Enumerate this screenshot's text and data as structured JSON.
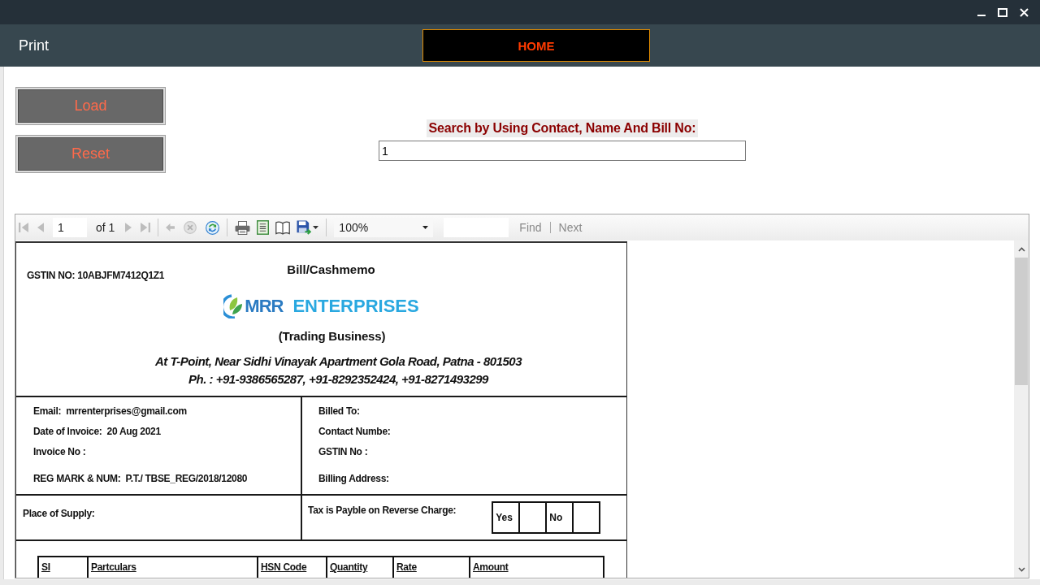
{
  "window": {
    "title": "Print",
    "home_button": "HOME"
  },
  "actions": {
    "buttons": [
      "Load",
      "Reset"
    ]
  },
  "search": {
    "label": "Search by Using Contact, Name And Bill No:",
    "value": "1"
  },
  "report_viewer": {
    "toolbar": {
      "groups": [
        {
          "items": [
            {
              "kind": "first",
              "disabled": true
            },
            {
              "kind": "previous",
              "disabled": true
            },
            {
              "kind": "page",
              "value": "1",
              "disabled": false
            },
            {
              "kind": "count",
              "label": "of 1",
              "disabled": false
            },
            {
              "kind": "next",
              "disabled": true
            },
            {
              "kind": "last",
              "disabled": true
            }
          ]
        },
        {
          "items": [
            {
              "kind": "back",
              "disabled": true
            },
            {
              "kind": "stop",
              "disabled": true
            },
            {
              "kind": "refresh",
              "disabled": false
            }
          ]
        },
        {
          "items": [
            {
              "kind": "print",
              "disabled": false
            },
            {
              "kind": "page_setup",
              "disabled": false
            },
            {
              "kind": "layout",
              "disabled": false
            },
            {
              "kind": "export",
              "disabled": false
            }
          ]
        },
        {
          "items": [
            {
              "kind": "zoom",
              "value": "100%",
              "disabled": false
            }
          ]
        }
      ],
      "find": {
        "label": "Find",
        "disabled": true
      },
      "find_next": {
        "label": "Next",
        "disabled": true
      }
    },
    "document": {
      "gstin": "GSTIN NO: 10ABJFM7412Q1Z1",
      "title": "Bill/Cashmemo",
      "logo": {
        "mark": "MRR",
        "name": "ENTERPRISES"
      },
      "tagline": "(Trading Business)",
      "address": "At T-Point, Near Sidhi Vinayak Apartment Gola Road, Patna - 801503",
      "phone": "Ph. : +91-9386565287, +91-8292352424, +91-8271493299",
      "seller": [
        {
          "label": "Email:",
          "value": "mrrenterprises@gmail.com"
        },
        {
          "label": "Date of Invoice:",
          "value": "20 Aug 2021"
        },
        {
          "label": "Invoice No :"
        },
        {
          "label": "REG MARK & NUM:",
          "value": "P.T./ TBSE_REG/2018/12080"
        }
      ],
      "buyer": [
        {
          "label": "Billed To:"
        },
        {
          "label": "Contact Numbe:"
        },
        {
          "label": "GSTIN No :"
        },
        {
          "label": "Billing Address:"
        }
      ],
      "place_of_supply": "Place of Supply:",
      "reverse_charge": {
        "label": "Tax is Payble on Reverse Charge:",
        "options": [
          {
            "label": "Yes",
            "checked": false
          },
          {
            "label": "No",
            "checked": false
          }
        ]
      },
      "items_table": {
        "columns": [
          "SI",
          "Partculars",
          "HSN Code",
          "Quantity",
          "Rate",
          "Amount"
        ]
      }
    }
  }
}
